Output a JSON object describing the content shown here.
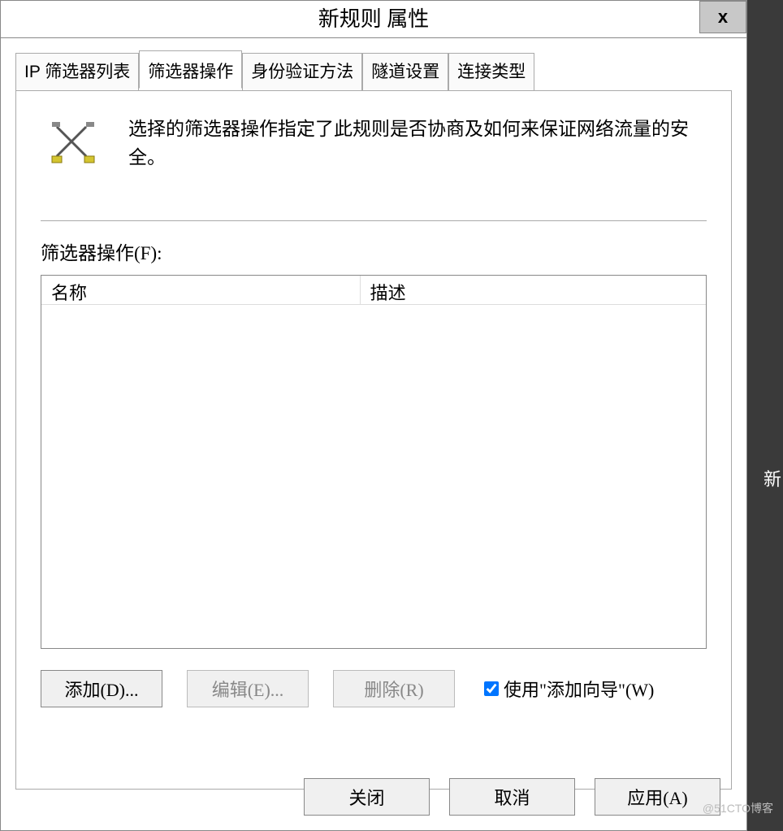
{
  "window": {
    "title": "新规则 属性",
    "close_symbol": "x"
  },
  "tabs": {
    "ip_filter_list": "IP 筛选器列表",
    "filter_action": "筛选器操作",
    "auth_method": "身份验证方法",
    "tunnel_setting": "隧道设置",
    "connection_type": "连接类型"
  },
  "panel": {
    "description": "选择的筛选器操作指定了此规则是否协商及如何来保证网络流量的安全。",
    "list_label": "筛选器操作(F):",
    "columns": {
      "name": "名称",
      "description": "描述"
    },
    "buttons": {
      "add": "添加(D)...",
      "edit": "编辑(E)...",
      "remove": "删除(R)"
    },
    "checkbox_label": "使用\"添加向导\"(W)"
  },
  "dialog_buttons": {
    "close": "关闭",
    "cancel": "取消",
    "apply": "应用(A)"
  },
  "side": "新",
  "watermark": "@51CTO博客"
}
